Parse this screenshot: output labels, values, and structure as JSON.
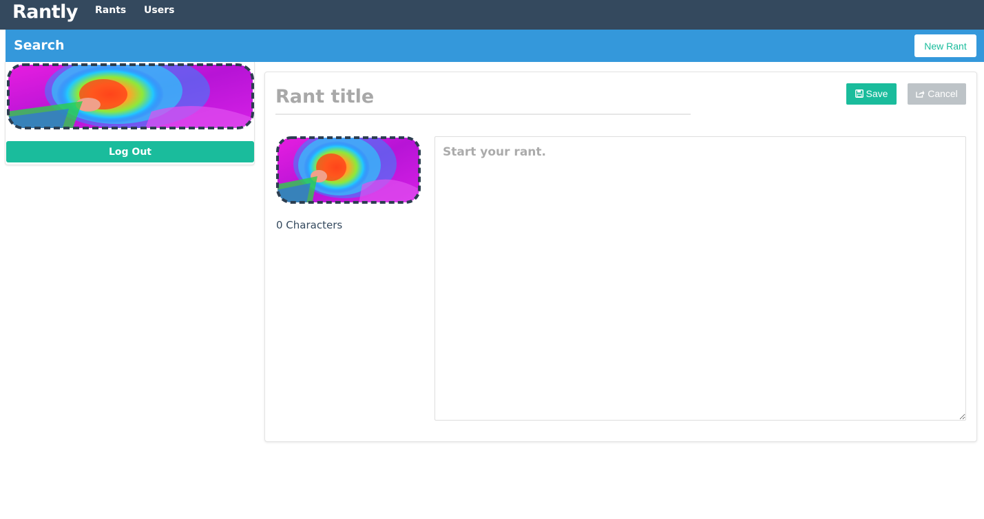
{
  "nav": {
    "brand": "Rantly",
    "links": [
      "Rants",
      "Users"
    ]
  },
  "searchbar": {
    "search_label": "Search",
    "new_rant_label": "New Rant"
  },
  "sidebar": {
    "avatar_icon": "thermal-avatar",
    "logout_label": "Log Out"
  },
  "editor": {
    "title_placeholder": "Rant title",
    "save_label": "Save",
    "cancel_label": "Cancel",
    "char_count": "0 Characters",
    "body_placeholder": "Start your rant.",
    "save_icon": "floppy-icon",
    "cancel_icon": "share-icon"
  },
  "colors": {
    "topnav": "#34495e",
    "searchbar": "#3498db",
    "accent": "#1abc9c",
    "cancel": "#bdc3c7"
  }
}
